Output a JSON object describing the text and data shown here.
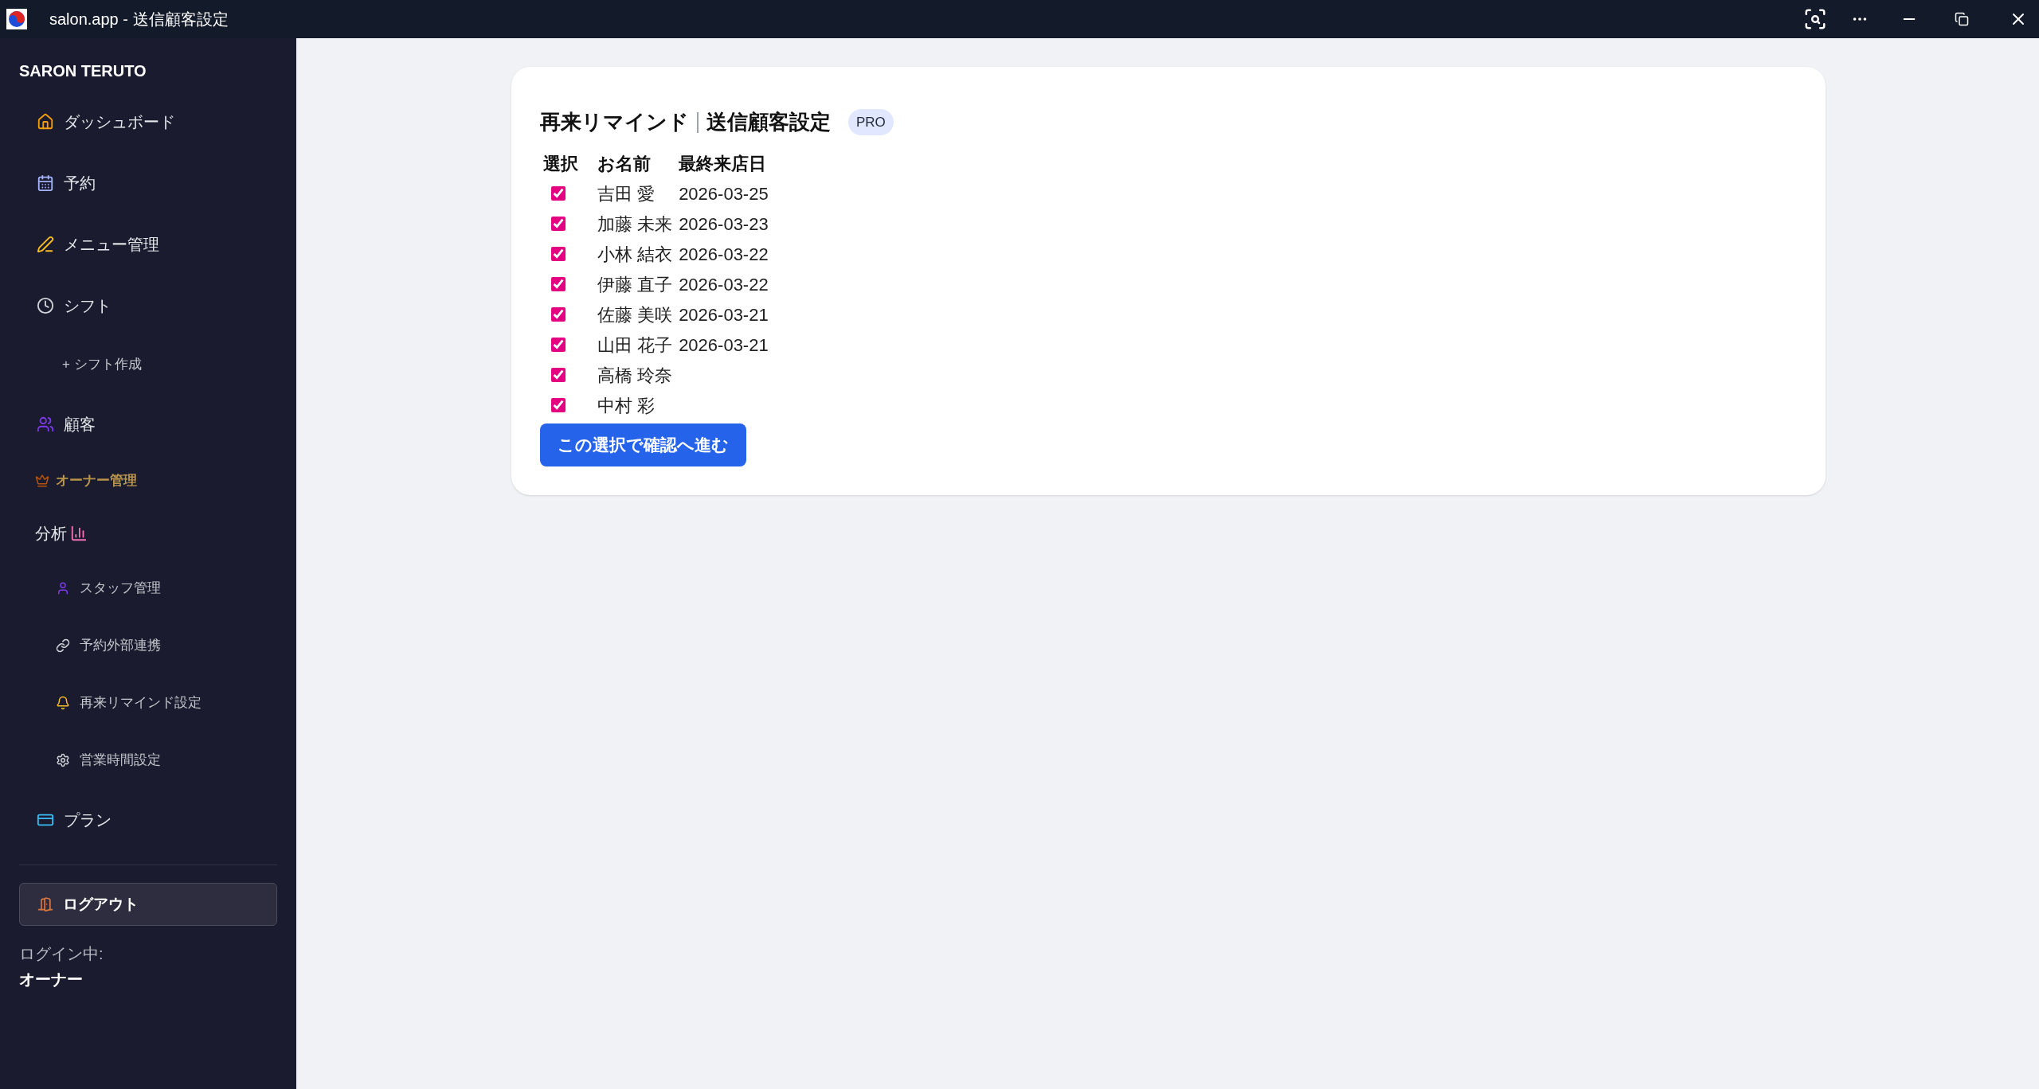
{
  "window": {
    "title": "salon.app - 送信顧客設定"
  },
  "sidebar": {
    "brand": "SARON TERUTO",
    "items": [
      {
        "kind": "main",
        "label": "ダッシュボード"
      },
      {
        "kind": "main",
        "label": "予約"
      },
      {
        "kind": "main",
        "label": "メニュー管理"
      },
      {
        "kind": "main",
        "label": "シフト"
      },
      {
        "kind": "sub",
        "label": "+ シフト作成"
      },
      {
        "kind": "main",
        "label": "顧客"
      },
      {
        "kind": "section",
        "label": "オーナー管理"
      },
      {
        "kind": "trailing",
        "label": "分析"
      },
      {
        "kind": "sub",
        "label": "スタッフ管理"
      },
      {
        "kind": "sub",
        "label": "予約外部連携"
      },
      {
        "kind": "sub",
        "label": "再来リマインド設定"
      },
      {
        "kind": "sub",
        "label": "営業時間設定"
      },
      {
        "kind": "main",
        "label": "プラン"
      }
    ],
    "logout": "ログアウト",
    "login_label": "ログイン中:",
    "login_user": "オーナー"
  },
  "card": {
    "title": "再来リマインド",
    "subtitle": "送信顧客設定",
    "badge": "PRO",
    "table": {
      "columns": [
        "選択",
        "お名前",
        "最終来店日"
      ],
      "rows": [
        {
          "checked": true,
          "name": "吉田 愛",
          "last_visit": "2026-03-25"
        },
        {
          "checked": true,
          "name": "加藤 未来",
          "last_visit": "2026-03-23"
        },
        {
          "checked": true,
          "name": "小林 結衣",
          "last_visit": "2026-03-22"
        },
        {
          "checked": true,
          "name": "伊藤 直子",
          "last_visit": "2026-03-22"
        },
        {
          "checked": true,
          "name": "佐藤 美咲",
          "last_visit": "2026-03-21"
        },
        {
          "checked": true,
          "name": "山田 花子",
          "last_visit": "2026-03-21"
        },
        {
          "checked": true,
          "name": "高橋 玲奈"
        },
        {
          "checked": true,
          "name": "中村 彩"
        }
      ]
    },
    "button": "この選択で確認へ進む"
  }
}
